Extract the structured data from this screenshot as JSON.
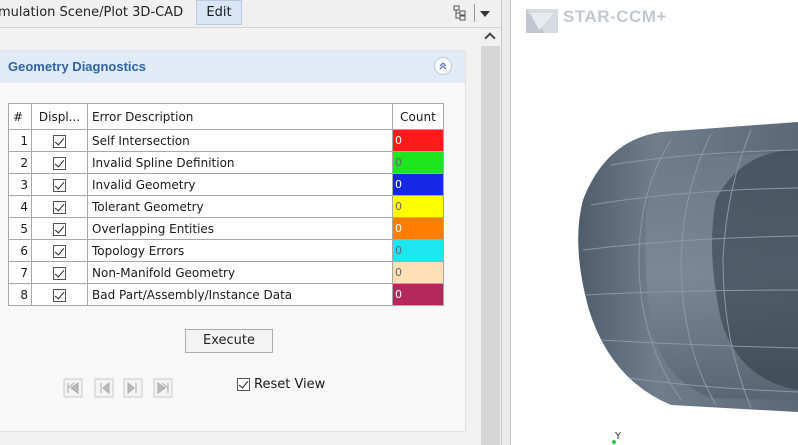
{
  "tabs": [
    {
      "label": "mulation Scene/Plot 3D-CAD"
    },
    {
      "label": "Edit"
    }
  ],
  "panel": {
    "title": "Geometry Diagnostics",
    "columns": [
      "#",
      "Displ...",
      "Error Description",
      "Count"
    ],
    "rows": [
      {
        "num": "1",
        "displayed": true,
        "desc": "Self Intersection",
        "count": "0",
        "color": "#ff1a1a"
      },
      {
        "num": "2",
        "displayed": true,
        "desc": "Invalid Spline Definition",
        "count": "0",
        "color": "#1ee61e"
      },
      {
        "num": "3",
        "displayed": true,
        "desc": "Invalid Geometry",
        "count": "0",
        "color": "#1428e6"
      },
      {
        "num": "4",
        "displayed": true,
        "desc": "Tolerant Geometry",
        "count": "0",
        "color": "#ffff00"
      },
      {
        "num": "5",
        "displayed": true,
        "desc": "Overlapping Entities",
        "count": "0",
        "color": "#ff7d00"
      },
      {
        "num": "6",
        "displayed": true,
        "desc": "Topology Errors",
        "count": "0",
        "color": "#1ee6f0"
      },
      {
        "num": "7",
        "displayed": true,
        "desc": "Non-Manifold Geometry",
        "count": "0",
        "color": "#ffe0b4"
      },
      {
        "num": "8",
        "displayed": true,
        "desc": "Bad Part/Assembly/Instance Data",
        "count": "0",
        "color": "#b4285a"
      }
    ],
    "execute_label": "Execute",
    "reset_view_label": "Reset View",
    "reset_view_checked": true,
    "nav_icons": [
      "first-icon",
      "previous-icon",
      "next-icon",
      "last-icon"
    ]
  },
  "viewer": {
    "logo_text": "STAR-CCM+",
    "axis_label": "Y"
  }
}
